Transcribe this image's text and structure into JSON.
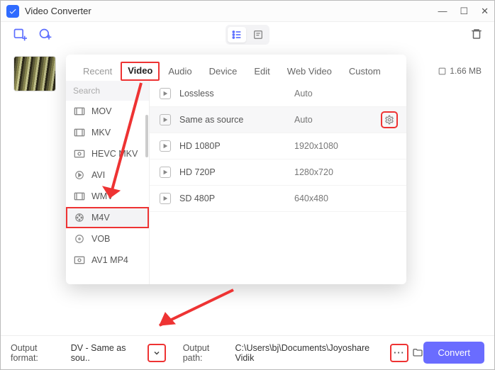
{
  "app": {
    "title": "Video Converter"
  },
  "file": {
    "size": "1.66 MB"
  },
  "tabs": {
    "recent": "Recent",
    "video": "Video",
    "audio": "Audio",
    "device": "Device",
    "edit": "Edit",
    "webvideo": "Web Video",
    "custom": "Custom"
  },
  "search": {
    "placeholder": "Search"
  },
  "formats": [
    {
      "label": "MOV"
    },
    {
      "label": "MKV"
    },
    {
      "label": "HEVC MKV"
    },
    {
      "label": "AVI"
    },
    {
      "label": "WMV"
    },
    {
      "label": "M4V"
    },
    {
      "label": "VOB"
    },
    {
      "label": "AV1 MP4"
    }
  ],
  "presets": [
    {
      "name": "Lossless",
      "res": "Auto"
    },
    {
      "name": "Same as source",
      "res": "Auto"
    },
    {
      "name": "HD 1080P",
      "res": "1920x1080"
    },
    {
      "name": "HD 720P",
      "res": "1280x720"
    },
    {
      "name": "SD 480P",
      "res": "640x480"
    }
  ],
  "footer": {
    "format_label": "Output format:",
    "format_value": "DV - Same as sou..",
    "path_label": "Output path:",
    "path_value": "C:\\Users\\bj\\Documents\\Joyoshare Vidik",
    "browse": "···",
    "convert": "Convert"
  },
  "colors": {
    "accent": "#6a6cff",
    "highlight": "#e33"
  }
}
